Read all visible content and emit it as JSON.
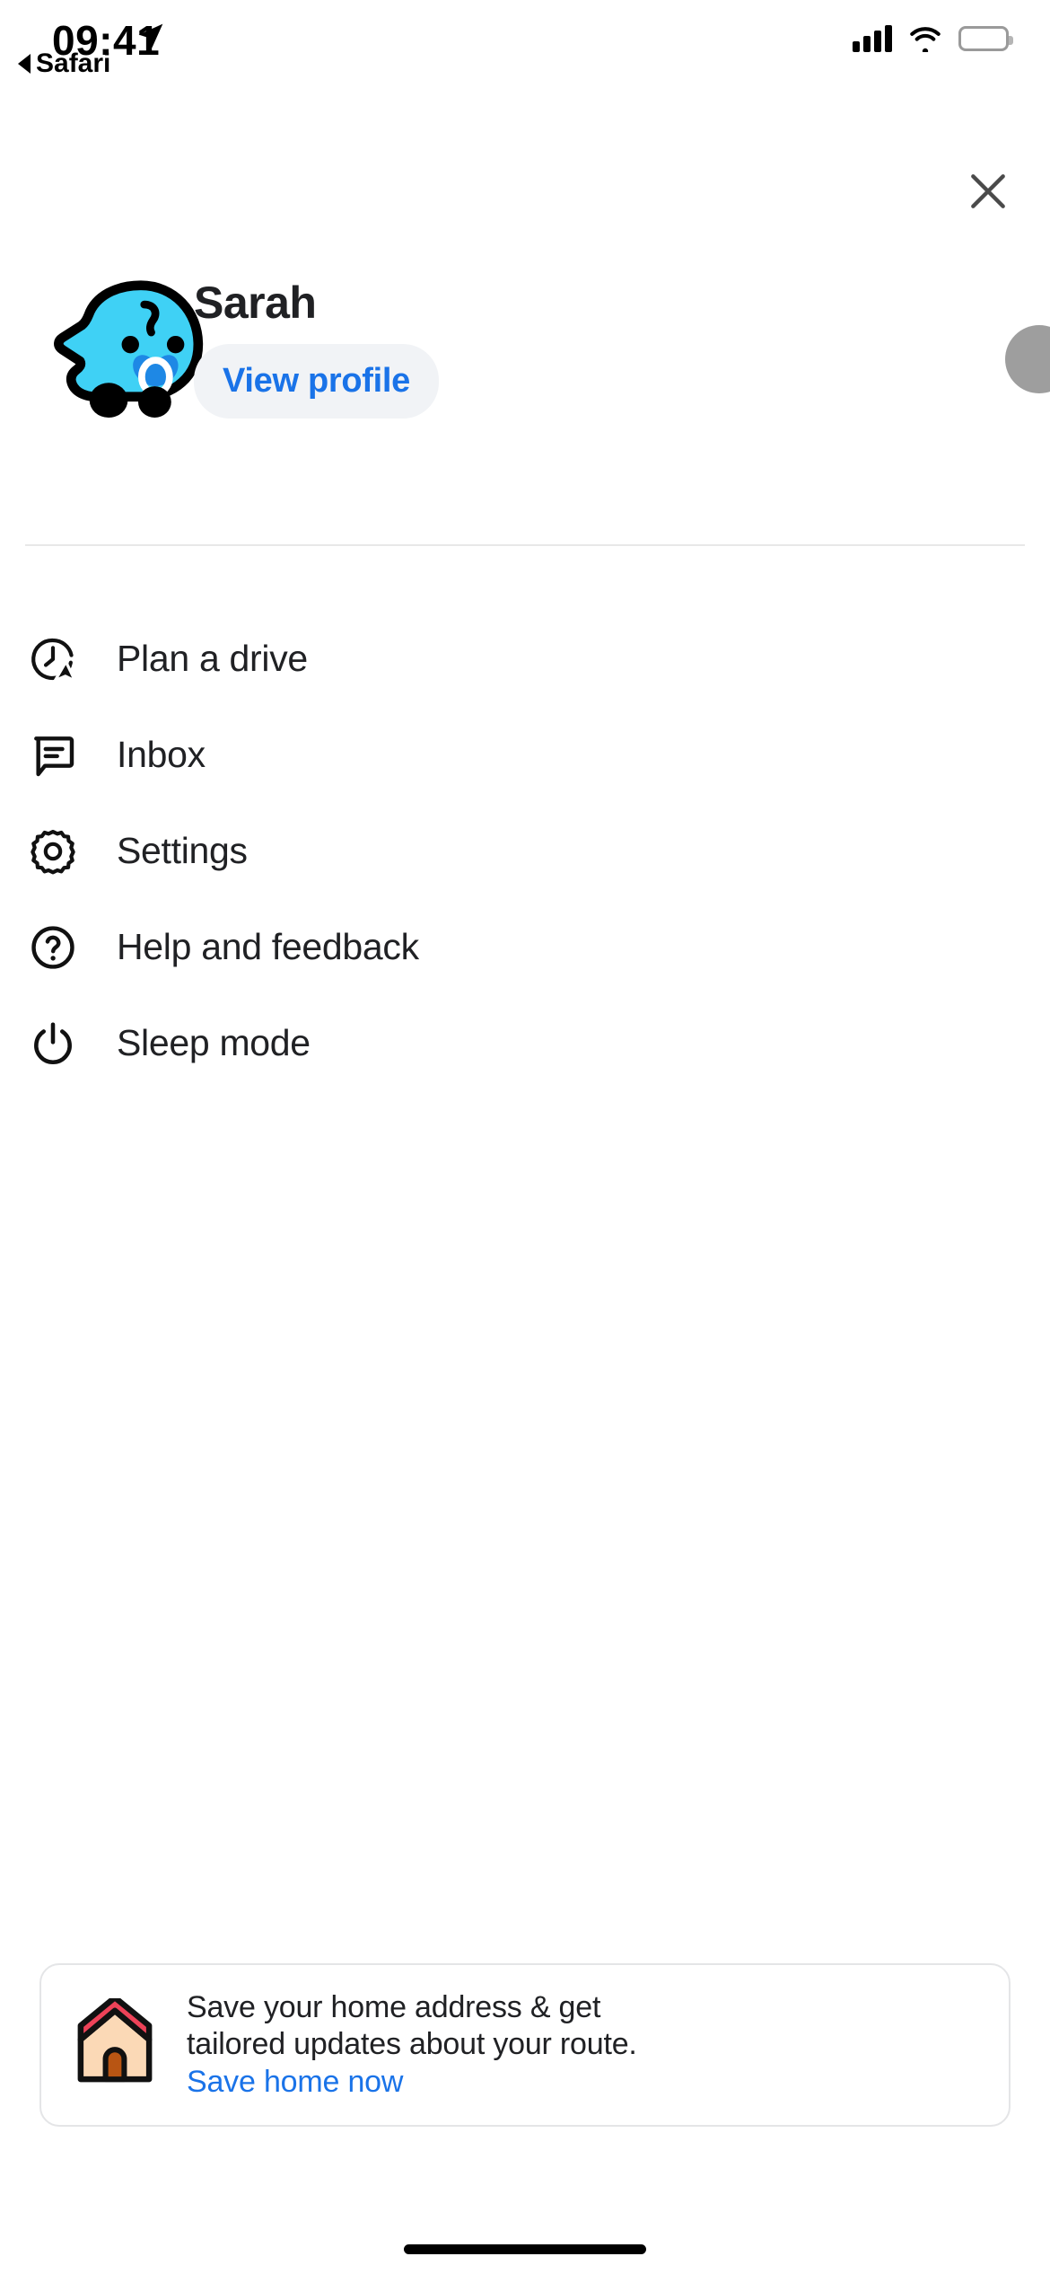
{
  "status_bar": {
    "time": "09:41",
    "back_label": "Safari",
    "location_icon": "location-arrow-icon",
    "cellular_icon": "cellular-bars-icon",
    "wifi_icon": "wifi-icon",
    "battery_icon": "battery-low-power-icon",
    "battery_color": "#FCD116"
  },
  "header": {
    "close_icon": "close-x-icon",
    "close_color": "#4a4a4a"
  },
  "profile": {
    "name": "Sarah",
    "view_profile_label": "View profile",
    "avatar_icon": "waze-baby-mood-avatar",
    "avatar_body_color": "#3FD1F5",
    "avatar_pacifier_color": "#1E88E5",
    "corner_avatar_icon": "user-avatar-circle",
    "corner_avatar_color": "#9e9e9e",
    "button_bg": "#F1F3F6",
    "button_text_color": "#1A73E8"
  },
  "menu": {
    "items": [
      {
        "label": "Plan a drive",
        "icon": "clock-navigation-icon"
      },
      {
        "label": "Inbox",
        "icon": "chat-bubble-icon"
      },
      {
        "label": "Settings",
        "icon": "gear-icon"
      },
      {
        "label": "Help and feedback",
        "icon": "question-mark-circle-icon"
      },
      {
        "label": "Sleep mode",
        "icon": "power-icon"
      }
    ]
  },
  "home_card": {
    "icon": "house-icon",
    "roof_color": "#ED4258",
    "wall_color": "#FBD9B6",
    "door_color": "#B85513",
    "line1": "Save your home address & get",
    "line2": "tailored updates about your route.",
    "link_label": "Save home now",
    "link_color": "#1A73E8"
  },
  "system": {
    "home_indicator": "home-indicator-bar"
  }
}
